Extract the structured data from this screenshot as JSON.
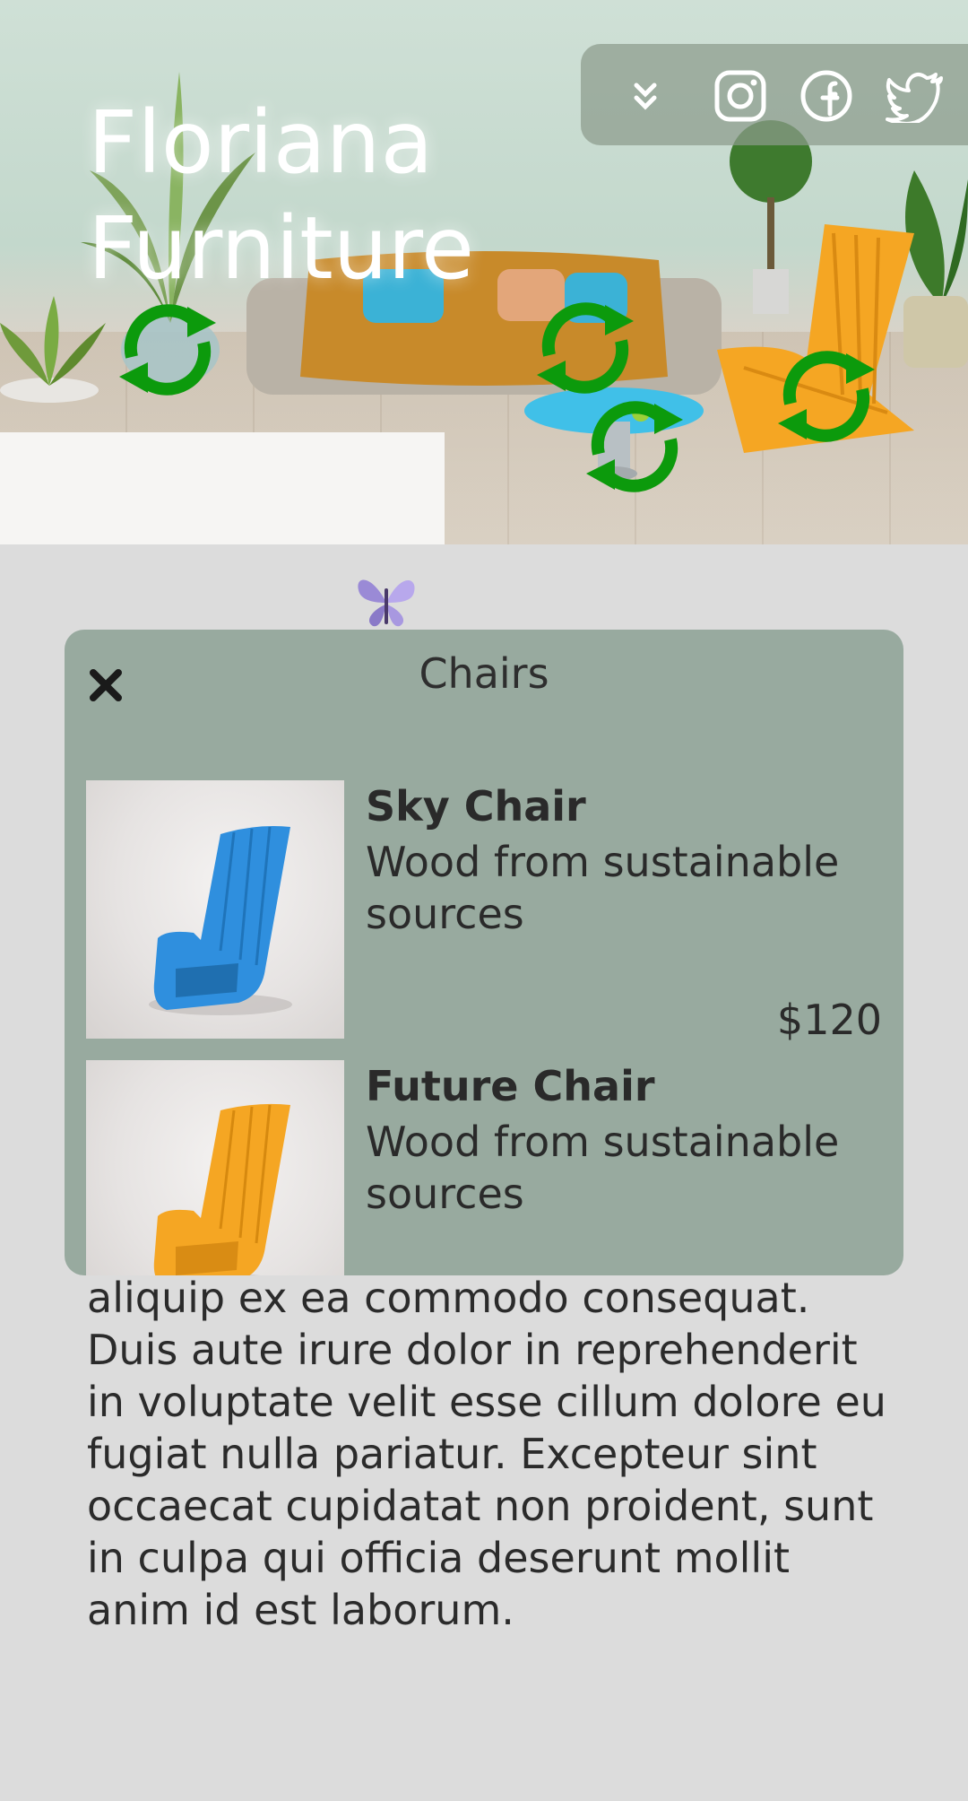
{
  "hero": {
    "brand_line1": "Floriana",
    "brand_line2": "Furniture",
    "social": {
      "menu_icon": "double-chevron-down-icon",
      "icons": [
        "instagram-icon",
        "facebook-icon",
        "twitter-icon"
      ]
    }
  },
  "modal": {
    "title": "Chairs",
    "close_icon": "close-icon",
    "products": [
      {
        "name": "Sky Chair",
        "description": "Wood from sustainable sources",
        "price": "$120",
        "image": "blue-chair-image"
      },
      {
        "name": "Future Chair",
        "description": "Wood from sustainable sources",
        "image": "orange-chair-image"
      }
    ]
  },
  "body_text": "aliquip ex ea commodo consequat. Duis aute irure dolor in reprehenderit in voluptate velit esse cillum dolore eu fugiat nulla pariatur. Excepteur sint occaecat cupidatat non proident, sunt in culpa qui officia deserunt mollit anim id est laborum.",
  "colors": {
    "page_bg": "#dcdcdc",
    "modal_bg": "#98aa9f",
    "recycle_green": "#0c9a0c",
    "chair_blue": "#2f8fde",
    "chair_orange": "#f5a623"
  }
}
